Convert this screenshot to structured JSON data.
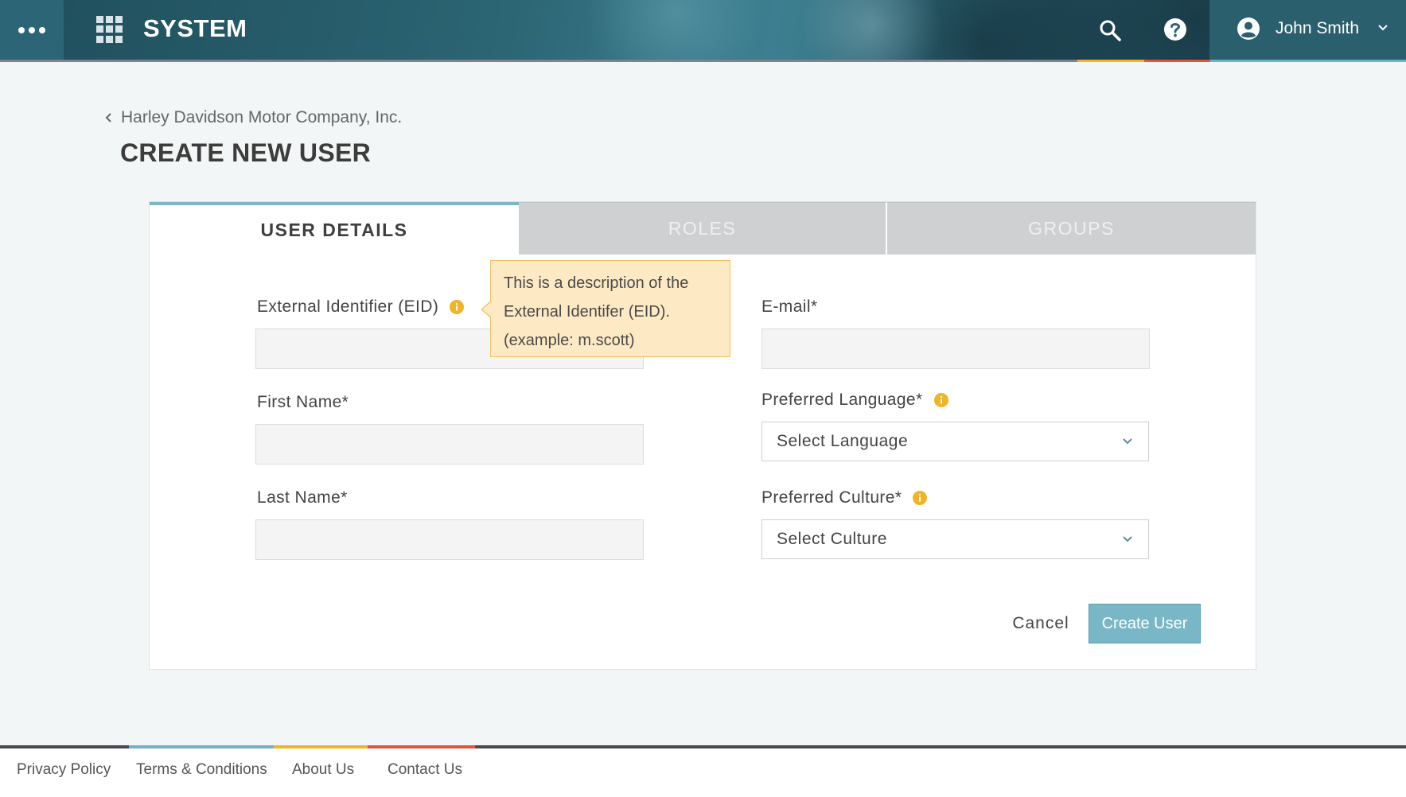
{
  "header": {
    "app_title": "SYSTEM",
    "user_name": "John Smith",
    "icons": [
      "more-dots-icon",
      "apps-grid-icon",
      "search-icon",
      "help-icon",
      "account-circle-icon",
      "chevron-down-icon"
    ],
    "accent_colors": [
      "#f0b429",
      "#e3553b",
      "#6fb3c6"
    ]
  },
  "page": {
    "breadcrumb": "Harley Davidson Motor Company, Inc.",
    "title": "CREATE NEW USER"
  },
  "tabs": [
    {
      "label": "USER DETAILS",
      "active": true
    },
    {
      "label": "ROLES",
      "active": false
    },
    {
      "label": "GROUPS",
      "active": false
    }
  ],
  "form": {
    "eid_label": "External Identifier (EID)",
    "eid_value": "",
    "first_name_label": "First Name*",
    "first_name_value": "",
    "last_name_label": "Last Name*",
    "last_name_value": "",
    "email_label": "E-mail*",
    "email_value": "",
    "language_label": "Preferred Language*",
    "language_selected": "Select Language",
    "culture_label": "Preferred Culture*",
    "culture_selected": "Select Culture",
    "tooltip_lines": [
      "This is a description of the",
      "External Identifer (EID).",
      "(example: m.scott)"
    ],
    "cancel_label": "Cancel",
    "submit_label": "Create User"
  },
  "colors": {
    "primary_button": "#79b6c6",
    "info_icon": "#f0b429",
    "tooltip_bg": "#fde9c3"
  },
  "footer": {
    "links": [
      "Privacy Policy",
      "Terms & Conditions",
      "About Us",
      "Contact Us"
    ]
  }
}
